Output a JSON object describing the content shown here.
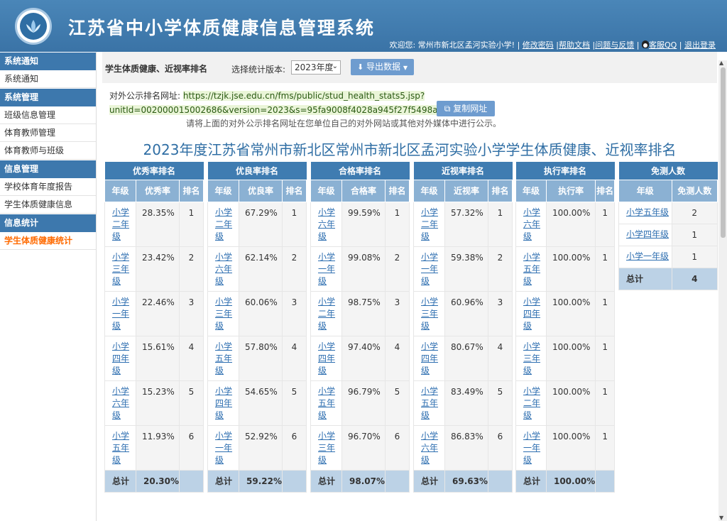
{
  "header": {
    "title": "江苏省中小学体质健康信息管理系统",
    "welcome": "欢迎您: 常州市新北区孟河实验小学! |",
    "links": [
      "修改密码",
      "帮助文档",
      "问题与反馈",
      "客服QQ",
      "退出登录"
    ],
    "link_sep": "|"
  },
  "sidebar": {
    "groups": [
      {
        "heading": "系统通知",
        "items": [
          "系统通知"
        ]
      },
      {
        "heading": "系统管理",
        "items": [
          "班级信息管理",
          "体育教师管理",
          "体育教师与班级"
        ]
      },
      {
        "heading": "信息管理",
        "items": [
          "学校体育年度报告",
          "学生体质健康信息"
        ]
      },
      {
        "heading": "信息统计",
        "items": [
          "学生体质健康统计"
        ]
      }
    ],
    "active_item": "学生体质健康统计"
  },
  "toolbar": {
    "page_title": "学生体质健康、近视率排名",
    "version_label": "选择统计版本:",
    "version_value": "2023年度",
    "export_label": "导出数据"
  },
  "public_url": {
    "label": "对外公示排名网址:",
    "line1": "https://tzjk.jse.edu.cn/fms/public/stud_health_stats5.jsp?",
    "line2": "unitId=002000015002686&version=2023&s=95fa9008f4028a945f27f5498a78e13f",
    "copy_label": "复制网址",
    "hint": "请将上面的对外公示排名网址在您单位自己的对外网站或其他对外媒体中进行公示。"
  },
  "report_title": "2023年度江苏省常州市新北区常州市新北区孟河实验小学学生体质健康、近视率排名",
  "tables": [
    {
      "caption": "优秀率排名",
      "cols": [
        "年级",
        "优秀率",
        "排名"
      ],
      "rows": [
        [
          "小学二年级",
          "28.35%",
          "1"
        ],
        [
          "小学三年级",
          "23.42%",
          "2"
        ],
        [
          "小学一年级",
          "22.46%",
          "3"
        ],
        [
          "小学四年级",
          "15.61%",
          "4"
        ],
        [
          "小学六年级",
          "15.23%",
          "5"
        ],
        [
          "小学五年级",
          "11.93%",
          "6"
        ]
      ],
      "total": [
        "总计",
        "20.30%",
        ""
      ]
    },
    {
      "caption": "优良率排名",
      "cols": [
        "年级",
        "优良率",
        "排名"
      ],
      "rows": [
        [
          "小学二年级",
          "67.29%",
          "1"
        ],
        [
          "小学六年级",
          "62.14%",
          "2"
        ],
        [
          "小学三年级",
          "60.06%",
          "3"
        ],
        [
          "小学五年级",
          "57.80%",
          "4"
        ],
        [
          "小学四年级",
          "54.65%",
          "5"
        ],
        [
          "小学一年级",
          "52.92%",
          "6"
        ]
      ],
      "total": [
        "总计",
        "59.22%",
        ""
      ]
    },
    {
      "caption": "合格率排名",
      "cols": [
        "年级",
        "合格率",
        "排名"
      ],
      "rows": [
        [
          "小学六年级",
          "99.59%",
          "1"
        ],
        [
          "小学一年级",
          "99.08%",
          "2"
        ],
        [
          "小学二年级",
          "98.75%",
          "3"
        ],
        [
          "小学四年级",
          "97.40%",
          "4"
        ],
        [
          "小学五年级",
          "96.79%",
          "5"
        ],
        [
          "小学三年级",
          "96.70%",
          "6"
        ]
      ],
      "total": [
        "总计",
        "98.07%",
        ""
      ]
    },
    {
      "caption": "近视率排名",
      "cols": [
        "年级",
        "近视率",
        "排名"
      ],
      "rows": [
        [
          "小学二年级",
          "57.32%",
          "1"
        ],
        [
          "小学一年级",
          "59.38%",
          "2"
        ],
        [
          "小学三年级",
          "60.96%",
          "3"
        ],
        [
          "小学四年级",
          "80.67%",
          "4"
        ],
        [
          "小学五年级",
          "83.49%",
          "5"
        ],
        [
          "小学六年级",
          "86.83%",
          "6"
        ]
      ],
      "total": [
        "总计",
        "69.63%",
        ""
      ]
    },
    {
      "caption": "执行率排名",
      "cols": [
        "年级",
        "执行率",
        "排名"
      ],
      "rows": [
        [
          "小学六年级",
          "100.00%",
          "1"
        ],
        [
          "小学五年级",
          "100.00%",
          "1"
        ],
        [
          "小学四年级",
          "100.00%",
          "1"
        ],
        [
          "小学三年级",
          "100.00%",
          "1"
        ],
        [
          "小学二年级",
          "100.00%",
          "1"
        ],
        [
          "小学一年级",
          "100.00%",
          "1"
        ]
      ],
      "total": [
        "总计",
        "100.00%",
        ""
      ]
    },
    {
      "caption": "免测人数",
      "cols": [
        "年级",
        "免测人数"
      ],
      "rows": [
        [
          "小学五年级",
          "2"
        ],
        [
          "小学四年级",
          "1"
        ],
        [
          "小学一年级",
          "1"
        ]
      ],
      "total": [
        "总计",
        "4"
      ]
    }
  ],
  "colors": {
    "header_bg": "#3a73a6",
    "table_caption": "#3f7cb1",
    "table_head": "#8bb1d3",
    "active_menu": "#ff6a00",
    "link": "#2d6eb0"
  },
  "icons": {
    "logo": "lotus-logo-icon",
    "export": "download-icon",
    "copy": "copy-icon",
    "qq": "qq-penguin-icon",
    "caret": "chevron-down-icon"
  }
}
